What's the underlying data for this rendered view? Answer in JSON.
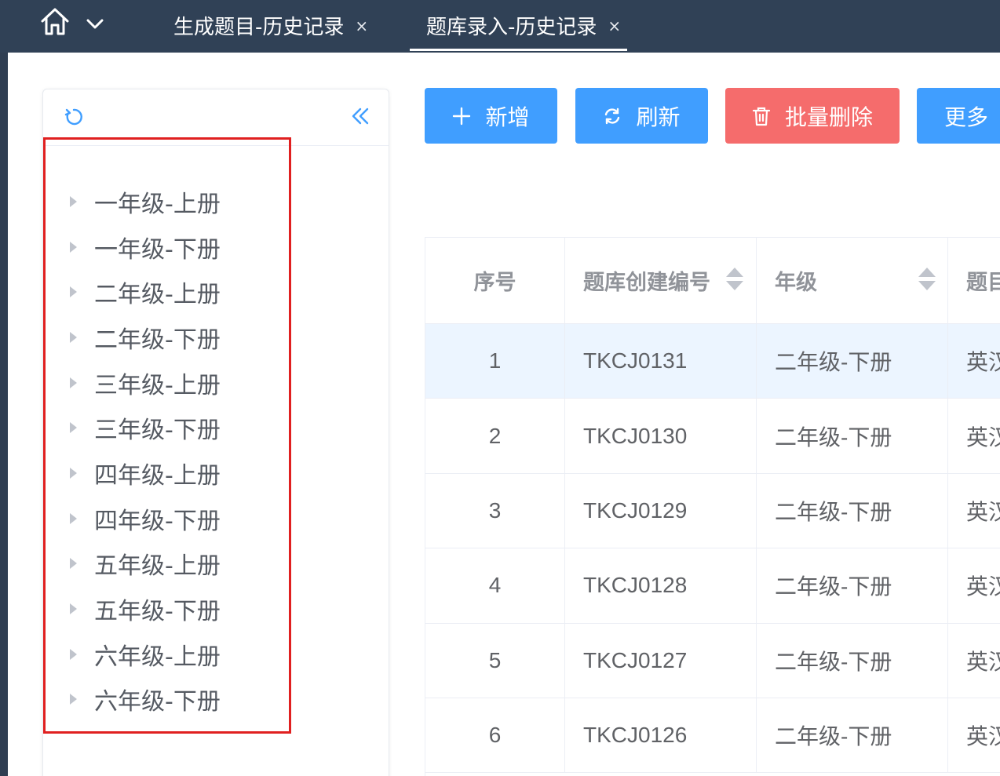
{
  "tabs": [
    {
      "label": "生成题目-历史记录",
      "close": "×"
    },
    {
      "label": "题库录入-历史记录",
      "close": "×"
    }
  ],
  "tree": {
    "items": [
      "一年级-上册",
      "一年级-下册",
      "二年级-上册",
      "二年级-下册",
      "三年级-上册",
      "三年级-下册",
      "四年级-上册",
      "四年级-下册",
      "五年级-上册",
      "五年级-下册",
      "六年级-上册",
      "六年级-下册"
    ]
  },
  "toolbar": {
    "add_label": "新增",
    "refresh_label": "刷新",
    "delete_label": "批量删除",
    "more_label": "更多"
  },
  "table": {
    "columns": [
      "序号",
      "题库创建编号",
      "年级",
      "题目"
    ],
    "rows": [
      {
        "index": "1",
        "code": "TKCJ0131",
        "grade": "二年级-下册",
        "title": "英汉"
      },
      {
        "index": "2",
        "code": "TKCJ0130",
        "grade": "二年级-下册",
        "title": "英汉"
      },
      {
        "index": "3",
        "code": "TKCJ0129",
        "grade": "二年级-下册",
        "title": "英汉"
      },
      {
        "index": "4",
        "code": "TKCJ0128",
        "grade": "二年级-下册",
        "title": "英汉"
      },
      {
        "index": "5",
        "code": "TKCJ0127",
        "grade": "二年级-下册",
        "title": "英汉"
      },
      {
        "index": "6",
        "code": "TKCJ0126",
        "grade": "二年级-下册",
        "title": "英汉"
      }
    ]
  },
  "colors": {
    "topbar": "#304156",
    "primary": "#409eff",
    "danger": "#f56c6c",
    "highlight": "#e02020"
  }
}
